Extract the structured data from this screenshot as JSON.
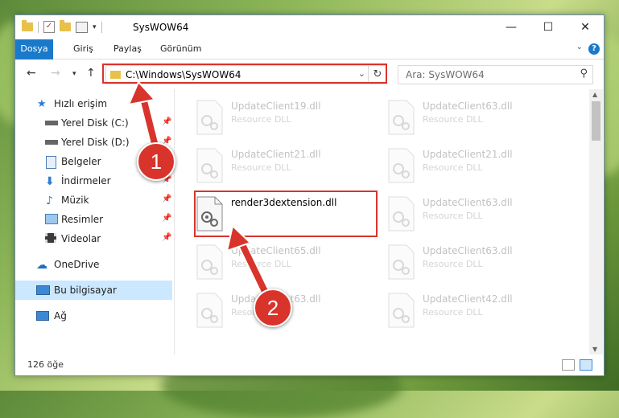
{
  "window": {
    "title": "SysWOW64",
    "controls": {
      "minimize": "—",
      "maximize": "☐",
      "close": "✕"
    }
  },
  "ribbon": {
    "tabs": [
      "Dosya",
      "Giriş",
      "Paylaş",
      "Görünüm"
    ],
    "help": "?"
  },
  "navbar": {
    "address": "C:\\Windows\\SysWOW64",
    "search_placeholder": "Ara: SysWOW64"
  },
  "sidebar": {
    "items": [
      {
        "label": "Hızlı erişim",
        "icon": "star-icon",
        "pinned": false
      },
      {
        "label": "Yerel Disk (C:)",
        "icon": "drive-icon",
        "pinned": true
      },
      {
        "label": "Yerel Disk (D:)",
        "icon": "drive-icon",
        "pinned": true
      },
      {
        "label": "Belgeler",
        "icon": "documents-icon",
        "pinned": true
      },
      {
        "label": "İndirmeler",
        "icon": "download-icon",
        "pinned": true
      },
      {
        "label": "Müzik",
        "icon": "music-icon",
        "pinned": true
      },
      {
        "label": "Resimler",
        "icon": "pictures-icon",
        "pinned": true
      },
      {
        "label": "Videolar",
        "icon": "video-icon",
        "pinned": true
      },
      {
        "label": "OneDrive",
        "icon": "cloud-icon",
        "pinned": false
      },
      {
        "label": "Bu bilgisayar",
        "icon": "computer-icon",
        "pinned": false,
        "selected": true
      },
      {
        "label": "Ağ",
        "icon": "network-icon",
        "pinned": false
      }
    ]
  },
  "files": [
    {
      "name": "UpdateClient19.dll",
      "type": "Resource DLL"
    },
    {
      "name": "UpdateClient63.dll",
      "type": "Resource DLL"
    },
    {
      "name": "UpdateClient21.dll",
      "type": "Resource DLL"
    },
    {
      "name": "UpdateClient21.dll",
      "type": "Resource DLL"
    },
    {
      "name": "render3dextension.dll",
      "type": ""
    },
    {
      "name": "UpdateClient63.dll",
      "type": "Resource DLL"
    },
    {
      "name": "UpdateClient65.dll",
      "type": "Resource DLL"
    },
    {
      "name": "UpdateClient63.dll",
      "type": "Resource DLL"
    },
    {
      "name": "UpdateClient63.dll",
      "type": "Resource DLL"
    },
    {
      "name": "UpdateClient42.dll",
      "type": "Resource DLL"
    }
  ],
  "status": {
    "count": "126 öğe"
  },
  "annotations": {
    "step1": "1",
    "step2": "2"
  },
  "colors": {
    "accent": "#1979ca",
    "highlight": "#d9342b",
    "selected_bg": "#cce8ff"
  }
}
